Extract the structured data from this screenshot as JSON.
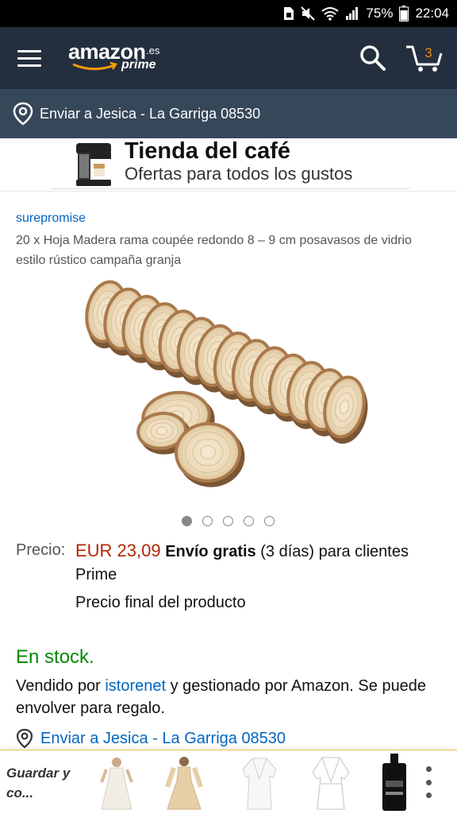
{
  "status_bar": {
    "battery_percent": "75%",
    "time": "22:04",
    "icons": [
      "sim-icon",
      "mute-icon",
      "wifi-icon",
      "signal-icon",
      "battery-icon"
    ]
  },
  "header": {
    "logo_word": "amazon",
    "logo_domain": ".es",
    "logo_prime": "prime",
    "cart_count": "3",
    "colors": {
      "background": "#232f3e",
      "accent": "#f08804"
    }
  },
  "deliver_bar": {
    "text": "Enviar a Jesica - La Garriga 08530",
    "background": "#37475a"
  },
  "banner": {
    "title": "Tienda del café",
    "subtitle": "Ofertas para todos los gustos"
  },
  "product": {
    "brand": "surepromise",
    "title": "20 x Hoja Madera rama coupée redondo 8 – 9 cm posavasos de vidrio estilo rústico campaña granja",
    "image_count": 5,
    "active_image": 1
  },
  "price": {
    "label": "Precio:",
    "value": "EUR 23,09",
    "shipping_bold": "Envío gratis",
    "shipping_rest": " (3 días) para clientes Prime",
    "final_note": "Precio final del producto",
    "price_color": "#b12704"
  },
  "availability": {
    "stock": "En stock.",
    "sold_prefix": "Vendido por ",
    "seller": "istorenet",
    "sold_suffix": " y gestionado por Amazon. Se puede envolver para regalo.",
    "stock_color": "#008a00"
  },
  "deliver_link": {
    "text": "Enviar a Jesica - La Garriga 08530"
  },
  "saved_bar": {
    "label": "Guardar y co...",
    "items": [
      "white-dress-thumb",
      "beige-gown-thumb",
      "white-robe-thumb",
      "satin-robe-thumb",
      "black-bottle-thumb"
    ]
  }
}
